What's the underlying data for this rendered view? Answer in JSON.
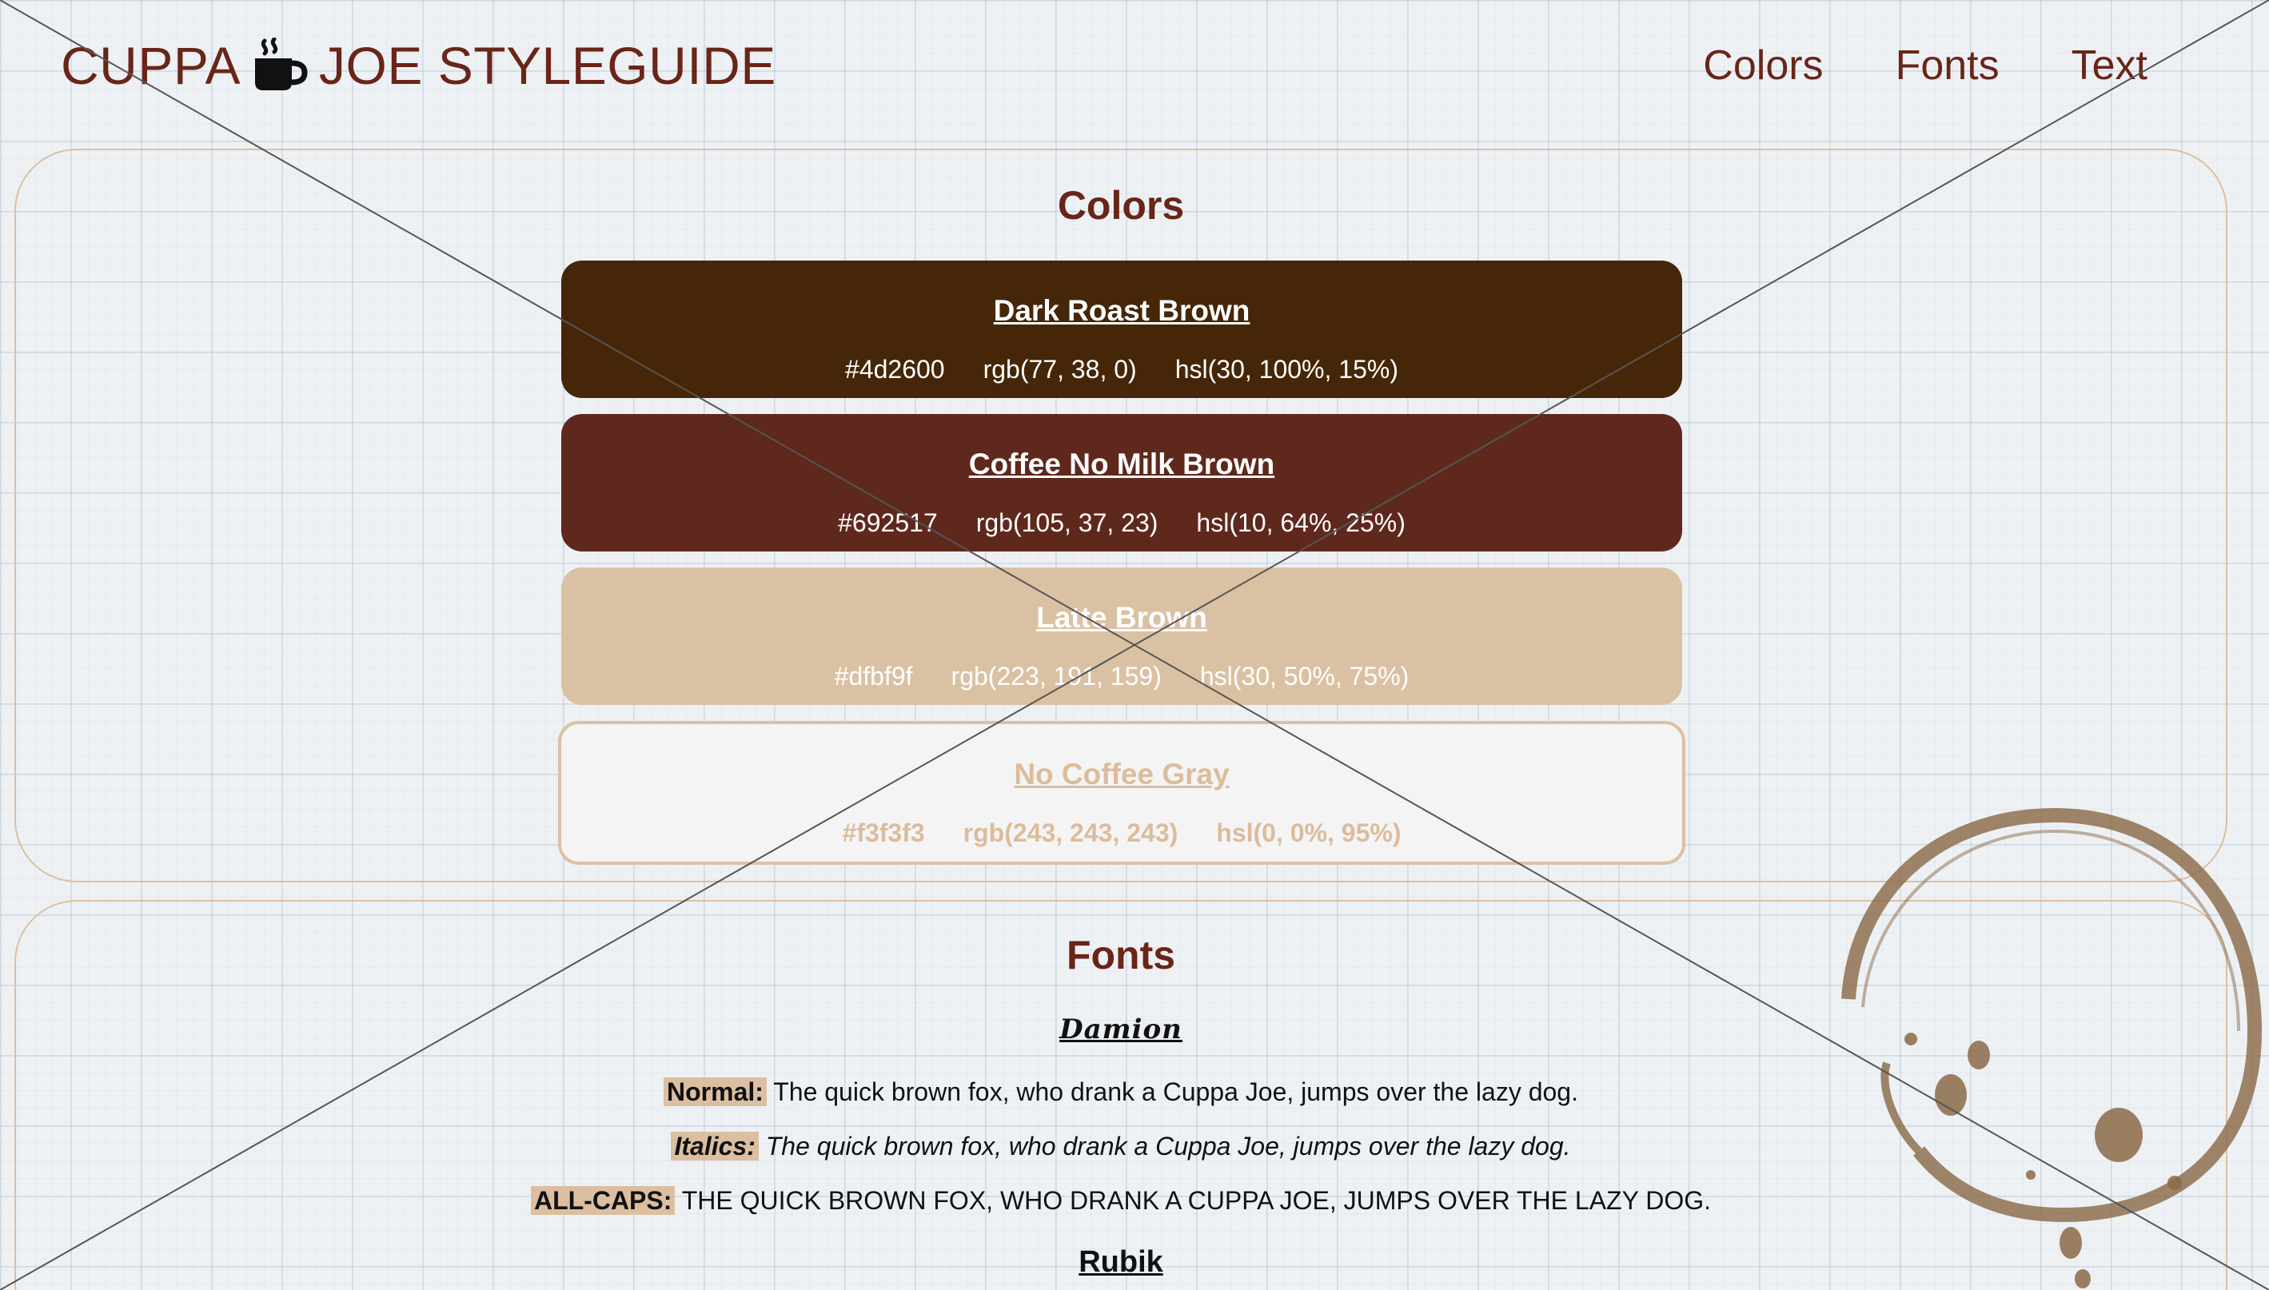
{
  "header": {
    "logo_left": "CUPPA",
    "logo_right": "JOE STYLEGUIDE",
    "logo_icon": "coffee-cup-icon",
    "nav": [
      {
        "label": "Colors"
      },
      {
        "label": "Fonts"
      },
      {
        "label": "Text"
      }
    ]
  },
  "colors_section": {
    "title": "Colors",
    "swatches": [
      {
        "name": "Dark Roast Brown",
        "hex": "#4d2600",
        "rgb": "rgb(77, 38, 0)",
        "hsl": "hsl(30, 100%, 15%)"
      },
      {
        "name": "Coffee No Milk Brown",
        "hex": "#692517",
        "rgb": "rgb(105, 37, 23)",
        "hsl": "hsl(10, 64%, 25%)"
      },
      {
        "name": "Latte Brown",
        "hex": "#dfbf9f",
        "rgb": "rgb(223, 191, 159)",
        "hsl": "hsl(30, 50%, 75%)"
      },
      {
        "name": "No Coffee Gray",
        "hex": "#f3f3f3",
        "rgb": "rgb(243, 243, 243)",
        "hsl": "hsl(0, 0%, 95%)"
      }
    ]
  },
  "fonts_section": {
    "title": "Fonts",
    "fonts": [
      {
        "name": "Damion",
        "samples": [
          {
            "label": "Normal:",
            "text": "The quick brown fox, who drank a Cuppa Joe, jumps over the lazy dog."
          },
          {
            "label": "Italics:",
            "text": "The quick brown fox, who drank a Cuppa Joe, jumps over the lazy dog."
          },
          {
            "label": "ALL-CAPS:",
            "text": "THE QUICK BROWN FOX, WHO DRANK A CUPPA JOE, JUMPS OVER THE LAZY DOG."
          }
        ]
      },
      {
        "name": "Rubik"
      }
    ]
  },
  "decorations": {
    "overlay": "placeholder-cross",
    "stain": "coffee-ring-stain"
  }
}
